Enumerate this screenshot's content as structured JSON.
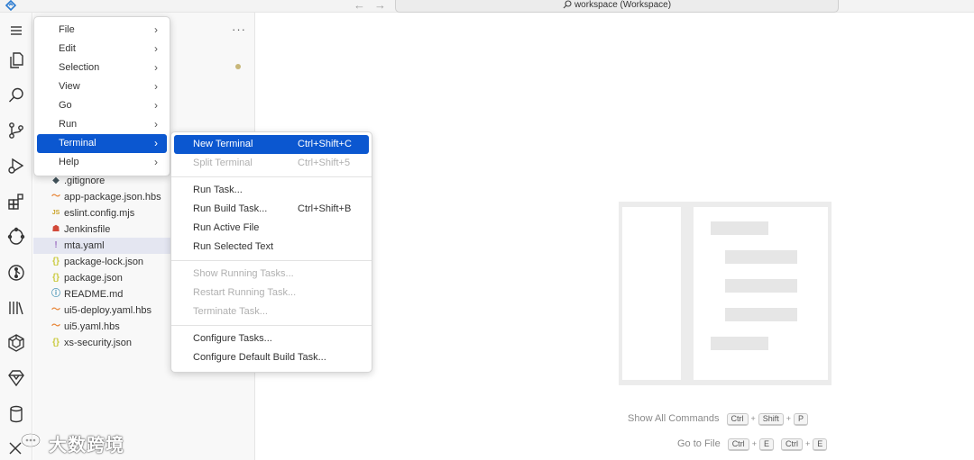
{
  "titlebar": {
    "search_text": "workspace (Workspace)",
    "back_icon": "arrow-left-icon",
    "forward_icon": "arrow-right-icon"
  },
  "activity_bar": {
    "items": [
      {
        "name": "menu-icon"
      },
      {
        "name": "explorer-icon"
      },
      {
        "name": "search-icon"
      },
      {
        "name": "source-control-icon"
      },
      {
        "name": "run-debug-icon"
      },
      {
        "name": "extensions-icon"
      },
      {
        "name": "remote-icon"
      },
      {
        "name": "git-icon"
      },
      {
        "name": "library-icon"
      },
      {
        "name": "cube-icon"
      },
      {
        "name": "gem-icon"
      },
      {
        "name": "database-icon"
      },
      {
        "name": "tools-icon"
      }
    ]
  },
  "main_menu": {
    "items": [
      {
        "label": "File"
      },
      {
        "label": "Edit"
      },
      {
        "label": "Selection"
      },
      {
        "label": "View"
      },
      {
        "label": "Go"
      },
      {
        "label": "Run"
      },
      {
        "label": "Terminal"
      },
      {
        "label": "Help"
      }
    ],
    "active": "Terminal"
  },
  "terminal_menu": {
    "groups": [
      [
        {
          "label": "New Terminal",
          "shortcut": "Ctrl+Shift+C",
          "state": "active"
        },
        {
          "label": "Split Terminal",
          "shortcut": "Ctrl+Shift+5",
          "state": "disabled"
        }
      ],
      [
        {
          "label": "Run Task...",
          "shortcut": "",
          "state": "enabled"
        },
        {
          "label": "Run Build Task...",
          "shortcut": "Ctrl+Shift+B",
          "state": "enabled"
        },
        {
          "label": "Run Active File",
          "shortcut": "",
          "state": "enabled"
        },
        {
          "label": "Run Selected Text",
          "shortcut": "",
          "state": "enabled"
        }
      ],
      [
        {
          "label": "Show Running Tasks...",
          "shortcut": "",
          "state": "disabled"
        },
        {
          "label": "Restart Running Task...",
          "shortcut": "",
          "state": "disabled"
        },
        {
          "label": "Terminate Task...",
          "shortcut": "",
          "state": "disabled"
        }
      ],
      [
        {
          "label": "Configure Tasks...",
          "shortcut": "",
          "state": "enabled"
        },
        {
          "label": "Configure Default Build Task...",
          "shortcut": "",
          "state": "enabled"
        }
      ]
    ]
  },
  "explorer": {
    "files": [
      {
        "name": ".gitignore",
        "icon": "git-diamond-icon",
        "icon_color": "#41535b"
      },
      {
        "name": "app-package.json.hbs",
        "icon": "handlebars-icon",
        "icon_color": "#e8873a"
      },
      {
        "name": "eslint.config.mjs",
        "icon": "js-module-icon",
        "icon_color": "#c9a227"
      },
      {
        "name": "Jenkinsfile",
        "icon": "jenkins-icon",
        "icon_color": "#d24939"
      },
      {
        "name": "mta.yaml",
        "icon": "yaml-icon",
        "icon_color": "#a074c4",
        "selected": true
      },
      {
        "name": "package-lock.json",
        "icon": "json-icon",
        "icon_color": "#cbcb41"
      },
      {
        "name": "package.json",
        "icon": "json-icon",
        "icon_color": "#cbcb41"
      },
      {
        "name": "README.md",
        "icon": "info-icon",
        "icon_color": "#519aba"
      },
      {
        "name": "ui5-deploy.yaml.hbs",
        "icon": "handlebars-icon",
        "icon_color": "#e8873a"
      },
      {
        "name": "ui5.yaml.hbs",
        "icon": "handlebars-icon",
        "icon_color": "#e8873a"
      },
      {
        "name": "xs-security.json",
        "icon": "json-icon",
        "icon_color": "#cbcb41"
      }
    ]
  },
  "editor": {
    "shortcuts": [
      {
        "label": "Show All Commands",
        "keys": [
          "Ctrl",
          "Shift",
          "P"
        ]
      },
      {
        "label": "Go to File",
        "keys": [
          "Ctrl",
          "E"
        ],
        "alt_keys": [
          "Ctrl",
          "E"
        ]
      }
    ]
  },
  "brand": {
    "text": "大数跨境",
    "logo": "speech-bubble-logo"
  },
  "colors": {
    "accent": "#0b57d0"
  }
}
